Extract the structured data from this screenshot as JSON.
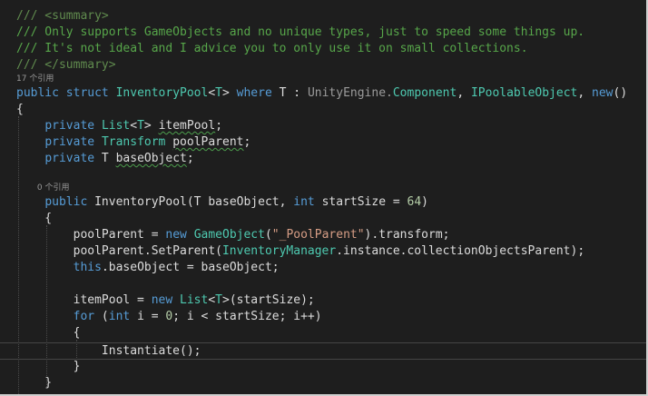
{
  "editor": {
    "lines": [
      {
        "tokens": [
          {
            "t": "/// <summary>",
            "c": "doc"
          }
        ]
      },
      {
        "tokens": [
          {
            "t": "/// Only supports GameObjects and no unique types, just to speed some things up.",
            "c": "com"
          }
        ]
      },
      {
        "tokens": [
          {
            "t": "/// It's not ideal and I advice you to only use it on small collections.",
            "c": "com"
          }
        ]
      },
      {
        "tokens": [
          {
            "t": "/// </summary>",
            "c": "doc"
          }
        ]
      },
      {
        "lens": "17 个引用"
      },
      {
        "tokens": [
          {
            "t": "public",
            "c": "kw"
          },
          {
            "t": " ",
            "c": "p"
          },
          {
            "t": "struct",
            "c": "kw"
          },
          {
            "t": " ",
            "c": "p"
          },
          {
            "t": "InventoryPool",
            "c": "type"
          },
          {
            "t": "<",
            "c": "p"
          },
          {
            "t": "T",
            "c": "type"
          },
          {
            "t": "> ",
            "c": "p"
          },
          {
            "t": "where",
            "c": "kw"
          },
          {
            "t": " T : ",
            "c": "p"
          },
          {
            "t": "UnityEngine.",
            "c": "ns"
          },
          {
            "t": "Component",
            "c": "type"
          },
          {
            "t": ", ",
            "c": "p"
          },
          {
            "t": "IPoolableObject",
            "c": "type"
          },
          {
            "t": ", ",
            "c": "p"
          },
          {
            "t": "new",
            "c": "kw"
          },
          {
            "t": "()",
            "c": "p"
          }
        ]
      },
      {
        "tokens": [
          {
            "t": "{",
            "c": "p"
          }
        ]
      },
      {
        "tokens": [
          {
            "t": "    ",
            "c": "p"
          },
          {
            "t": "private",
            "c": "kw"
          },
          {
            "t": " ",
            "c": "p"
          },
          {
            "t": "List",
            "c": "type"
          },
          {
            "t": "<",
            "c": "p"
          },
          {
            "t": "T",
            "c": "type"
          },
          {
            "t": "> ",
            "c": "p"
          },
          {
            "t": "itemPool",
            "c": "p",
            "u": true
          },
          {
            "t": ";",
            "c": "p"
          }
        ]
      },
      {
        "tokens": [
          {
            "t": "    ",
            "c": "p"
          },
          {
            "t": "private",
            "c": "kw"
          },
          {
            "t": " ",
            "c": "p"
          },
          {
            "t": "Transform",
            "c": "type"
          },
          {
            "t": " ",
            "c": "p"
          },
          {
            "t": "poolParent",
            "c": "p",
            "u": true
          },
          {
            "t": ";",
            "c": "p"
          }
        ]
      },
      {
        "tokens": [
          {
            "t": "    ",
            "c": "p"
          },
          {
            "t": "private",
            "c": "kw"
          },
          {
            "t": " T ",
            "c": "p"
          },
          {
            "t": "baseObject",
            "c": "p",
            "u": true
          },
          {
            "t": ";",
            "c": "p"
          }
        ]
      },
      {
        "tokens": []
      },
      {
        "lens": "        0 个引用"
      },
      {
        "tokens": [
          {
            "t": "    ",
            "c": "p"
          },
          {
            "t": "public",
            "c": "kw"
          },
          {
            "t": " InventoryPool(T baseObject, ",
            "c": "p"
          },
          {
            "t": "int",
            "c": "kw"
          },
          {
            "t": " startSize = ",
            "c": "p"
          },
          {
            "t": "64",
            "c": "num"
          },
          {
            "t": ")",
            "c": "p"
          }
        ]
      },
      {
        "tokens": [
          {
            "t": "    {",
            "c": "p"
          }
        ]
      },
      {
        "tokens": [
          {
            "t": "        poolParent = ",
            "c": "p"
          },
          {
            "t": "new",
            "c": "kw"
          },
          {
            "t": " ",
            "c": "p"
          },
          {
            "t": "GameObject",
            "c": "type"
          },
          {
            "t": "(",
            "c": "p"
          },
          {
            "t": "\"_PoolParent\"",
            "c": "str"
          },
          {
            "t": ").transform;",
            "c": "p"
          }
        ]
      },
      {
        "tokens": [
          {
            "t": "        poolParent.SetParent(",
            "c": "p"
          },
          {
            "t": "InventoryManager",
            "c": "type"
          },
          {
            "t": ".instance.collectionObjectsParent);",
            "c": "p"
          }
        ]
      },
      {
        "tokens": [
          {
            "t": "        ",
            "c": "p"
          },
          {
            "t": "this",
            "c": "kw"
          },
          {
            "t": ".baseObject = baseObject;",
            "c": "p"
          }
        ]
      },
      {
        "tokens": []
      },
      {
        "tokens": [
          {
            "t": "        itemPool = ",
            "c": "p"
          },
          {
            "t": "new",
            "c": "kw"
          },
          {
            "t": " ",
            "c": "p"
          },
          {
            "t": "List",
            "c": "type"
          },
          {
            "t": "<",
            "c": "p"
          },
          {
            "t": "T",
            "c": "type"
          },
          {
            "t": ">(startSize);",
            "c": "p"
          }
        ]
      },
      {
        "tokens": [
          {
            "t": "        ",
            "c": "p"
          },
          {
            "t": "for",
            "c": "kw"
          },
          {
            "t": " (",
            "c": "p"
          },
          {
            "t": "int",
            "c": "kw"
          },
          {
            "t": " i = ",
            "c": "p"
          },
          {
            "t": "0",
            "c": "num"
          },
          {
            "t": "; i < startSize; i++)",
            "c": "p"
          }
        ]
      },
      {
        "tokens": [
          {
            "t": "        {",
            "c": "p"
          }
        ]
      },
      {
        "current": true,
        "tokens": [
          {
            "t": "            Instantiate();",
            "c": "p"
          }
        ]
      },
      {
        "tokens": [
          {
            "t": "        }",
            "c": "p"
          }
        ]
      },
      {
        "tokens": [
          {
            "t": "    }",
            "c": "p"
          }
        ]
      }
    ]
  }
}
